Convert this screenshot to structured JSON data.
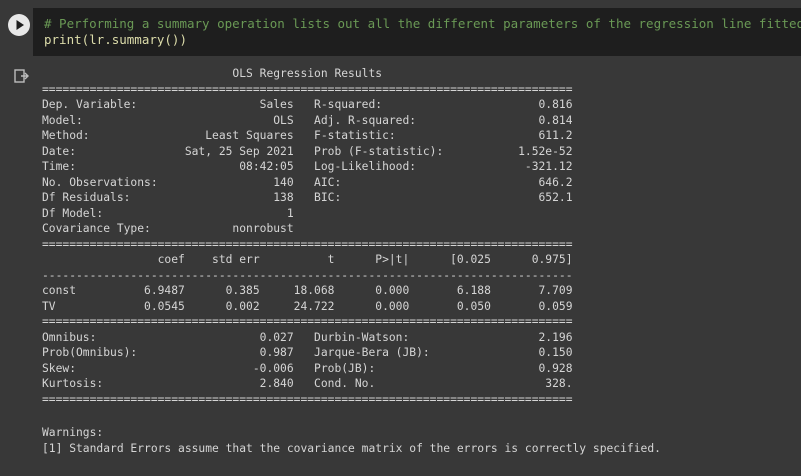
{
  "code_cell": {
    "comment": "# Performing a summary operation lists out all the different parameters of the regression line fitted",
    "code_line": "print(lr.summary())",
    "run_icon": "play-icon"
  },
  "output": {
    "output_icon": "output-redirect-icon",
    "summary_text": "                            OLS Regression Results                            \n==============================================================================\nDep. Variable:                  Sales   R-squared:                       0.816\nModel:                            OLS   Adj. R-squared:                  0.814\nMethod:                 Least Squares   F-statistic:                     611.2\nDate:                Sat, 25 Sep 2021   Prob (F-statistic):           1.52e-52\nTime:                        08:42:05   Log-Likelihood:                -321.12\nNo. Observations:                 140   AIC:                             646.2\nDf Residuals:                     138   BIC:                             652.1\nDf Model:                           1                                         \nCovariance Type:            nonrobust                                         \n==============================================================================\n                 coef    std err          t      P>|t|      [0.025      0.975]\n------------------------------------------------------------------------------\nconst          6.9487      0.385     18.068      0.000       6.188       7.709\nTV             0.0545      0.002     24.722      0.000       0.050       0.059\n==============================================================================\nOmnibus:                        0.027   Durbin-Watson:                   2.196\nProb(Omnibus):                  0.987   Jarque-Bera (JB):                0.150\nSkew:                          -0.006   Prob(JB):                        0.928\nKurtosis:                       2.840   Cond. No.                         328.\n==============================================================================",
    "warnings_header": "Warnings:",
    "warning_1": "[1] Standard Errors assume that the covariance matrix of the errors is correctly specified."
  }
}
